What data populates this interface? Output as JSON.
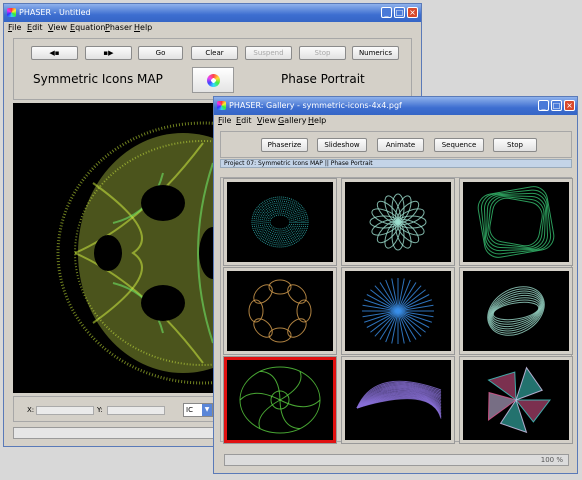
{
  "main_window": {
    "title": "PHASER - Untitled",
    "menu": [
      "File",
      "Edit",
      "View",
      "Equation",
      "Phaser",
      "Help"
    ],
    "toolbar": {
      "step_back": "◀▪",
      "step_forward": "▪▶",
      "go": "Go",
      "clear": "Clear",
      "suspend": "Suspend",
      "stop": "Stop",
      "numerics": "Numerics"
    },
    "map_name": "Symmetric Icons MAP",
    "view_label": "Phase Portrait",
    "x_label": "X:",
    "y_label": "Y:",
    "ic_label": "IC"
  },
  "gallery_window": {
    "title": "PHASER: Gallery - symmetric-icons-4x4.pgf",
    "menu": [
      "File",
      "Edit",
      "View",
      "Gallery",
      "Help"
    ],
    "toolbar": {
      "phaserize": "Phaserize",
      "slideshow": "Slideshow",
      "animate": "Animate",
      "sequence": "Sequence",
      "stop": "Stop"
    },
    "project_line": "Project 07: Symmetric Icons MAP || Phase Portrait",
    "progress_text": "100 %",
    "progress": 1.0,
    "tiles": [
      {
        "id": "t1",
        "color": "#2fb8b8",
        "shape": "disc"
      },
      {
        "id": "t2",
        "color": "#9ee0d0",
        "shape": "flower"
      },
      {
        "id": "t3",
        "color": "#36c070",
        "shape": "square"
      },
      {
        "id": "t4",
        "color": "#d8a050",
        "shape": "ring8"
      },
      {
        "id": "t5",
        "color": "#3a8fe8",
        "shape": "star"
      },
      {
        "id": "t6",
        "color": "#9ad8c8",
        "shape": "ellipse"
      },
      {
        "id": "t7",
        "color": "#5ad040",
        "shape": "icon",
        "selected": true
      },
      {
        "id": "t8",
        "color": "#8a70d8",
        "shape": "fan"
      },
      {
        "id": "t9",
        "color": "#e05890",
        "shape": "pinwheel"
      }
    ]
  }
}
